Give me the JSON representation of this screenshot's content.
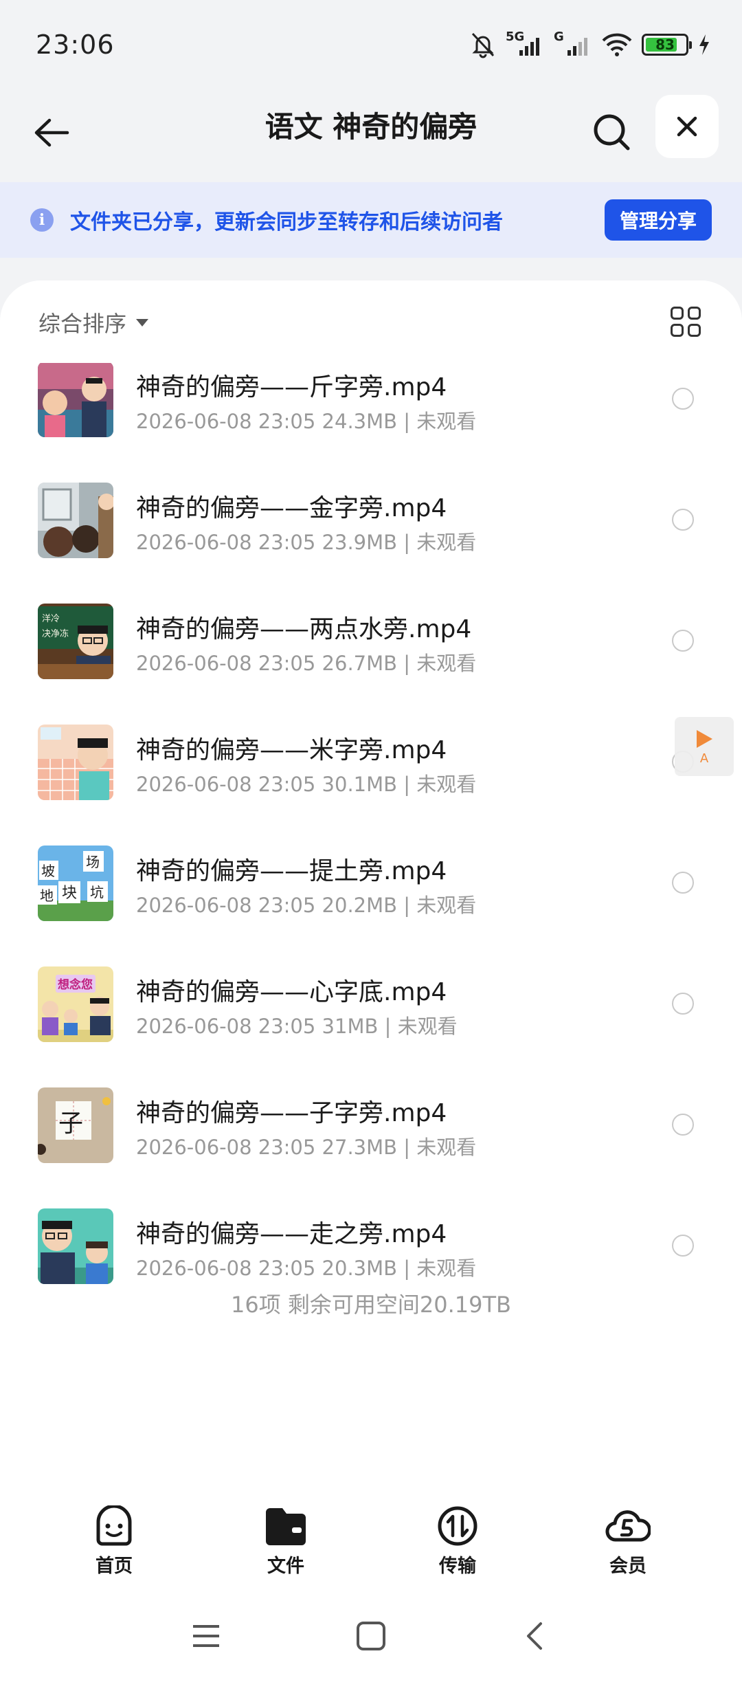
{
  "status_bar": {
    "time": "23:06",
    "signal1_label": "5G",
    "signal2_label": "G",
    "battery": "83",
    "battery_level": 0.83
  },
  "header": {
    "title": "语文 神奇的偏旁"
  },
  "share_banner": {
    "text": "文件夹已分享，更新会同步至转存和后续访问者",
    "manage_label": "管理分享"
  },
  "sort": {
    "label": "综合排序"
  },
  "files": [
    {
      "name": "神奇的偏旁——斤字旁.mp4",
      "meta": "2026-06-08 23:05  24.3MB | 未观看"
    },
    {
      "name": "神奇的偏旁——金字旁.mp4",
      "meta": "2026-06-08 23:05  23.9MB | 未观看"
    },
    {
      "name": "神奇的偏旁——两点水旁.mp4",
      "meta": "2026-06-08 23:05  26.7MB | 未观看"
    },
    {
      "name": "神奇的偏旁——米字旁.mp4",
      "meta": "2026-06-08 23:05  30.1MB | 未观看"
    },
    {
      "name": "神奇的偏旁——提土旁.mp4",
      "meta": "2026-06-08 23:05  20.2MB | 未观看"
    },
    {
      "name": "神奇的偏旁——心字底.mp4",
      "meta": "2026-06-08 23:05  31MB | 未观看"
    },
    {
      "name": "神奇的偏旁——子字旁.mp4",
      "meta": "2026-06-08 23:05  27.3MB | 未观看"
    },
    {
      "name": "神奇的偏旁——走之旁.mp4",
      "meta": "2026-06-08 23:05  20.3MB | 未观看"
    }
  ],
  "thumbs": {
    "t2": [
      "洋冷",
      "决净冻"
    ],
    "t5": [
      "坡",
      "场",
      "地",
      "块",
      "坑"
    ],
    "t6": "想念您",
    "t7": "子"
  },
  "summary": "16项 剩余可用空间20.19TB",
  "float_button": {
    "label": "A"
  },
  "bottom_nav": [
    {
      "label": "首页",
      "icon": "smile-icon"
    },
    {
      "label": "文件",
      "icon": "folder-icon"
    },
    {
      "label": "传输",
      "icon": "transfer-icon"
    },
    {
      "label": "会员",
      "icon": "cloud-vip-icon"
    }
  ],
  "colors": {
    "accent": "#1f54e8",
    "banner_bg": "#e8ecfb",
    "battery": "#35c13f"
  }
}
